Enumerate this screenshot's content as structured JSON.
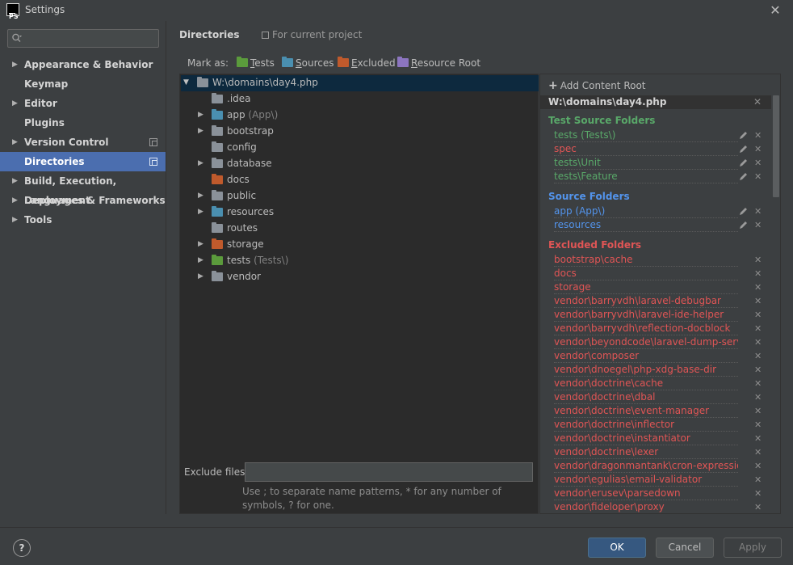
{
  "window": {
    "title": "Settings",
    "app_logo": "PS",
    "close_icon": "close-icon"
  },
  "sidebar": {
    "search": {
      "placeholder": "",
      "value": ""
    },
    "items": [
      {
        "label": "Appearance & Behavior",
        "has_arrow": true,
        "has_copy": false,
        "selected": false
      },
      {
        "label": "Keymap",
        "has_arrow": false,
        "has_copy": false,
        "selected": false
      },
      {
        "label": "Editor",
        "has_arrow": true,
        "has_copy": false,
        "selected": false
      },
      {
        "label": "Plugins",
        "has_arrow": false,
        "has_copy": false,
        "selected": false
      },
      {
        "label": "Version Control",
        "has_arrow": true,
        "has_copy": true,
        "selected": false
      },
      {
        "label": "Directories",
        "has_arrow": false,
        "has_copy": true,
        "selected": true
      },
      {
        "label": "Build, Execution, Deployment",
        "has_arrow": true,
        "has_copy": false,
        "selected": false
      },
      {
        "label": "Languages & Frameworks",
        "has_arrow": true,
        "has_copy": false,
        "selected": false
      },
      {
        "label": "Tools",
        "has_arrow": true,
        "has_copy": false,
        "selected": false
      }
    ]
  },
  "header": {
    "title": "Directories",
    "scope": "For current project"
  },
  "mark_as": {
    "label": "Mark as:",
    "buttons": [
      {
        "first": "T",
        "rest": "ests",
        "color": "#5b9b3c"
      },
      {
        "first": "S",
        "rest": "ources",
        "color": "#4a8fb0"
      },
      {
        "first": "E",
        "rest": "xcluded",
        "color": "#c05a2c"
      },
      {
        "first": "R",
        "rest": "esource Root",
        "color": "#8c75c0"
      }
    ]
  },
  "tree": {
    "root": "W:\\domains\\day4.php",
    "children": [
      {
        "name": ".idea",
        "hint": "",
        "expandable": false,
        "color": "#8a9199",
        "text_color": "#bbbbbb"
      },
      {
        "name": "app",
        "hint": " (App\\)",
        "expandable": true,
        "color": "#4a8fb0",
        "text_color": "#bbbbbb"
      },
      {
        "name": "bootstrap",
        "hint": "",
        "expandable": true,
        "color": "#8a9199",
        "text_color": "#bbbbbb"
      },
      {
        "name": "config",
        "hint": "",
        "expandable": false,
        "color": "#8a9199",
        "text_color": "#bbbbbb"
      },
      {
        "name": "database",
        "hint": "",
        "expandable": true,
        "color": "#8a9199",
        "text_color": "#bbbbbb"
      },
      {
        "name": "docs",
        "hint": "",
        "expandable": false,
        "color": "#c05a2c",
        "text_color": "#bbbbbb"
      },
      {
        "name": "public",
        "hint": "",
        "expandable": true,
        "color": "#8a9199",
        "text_color": "#bbbbbb"
      },
      {
        "name": "resources",
        "hint": "",
        "expandable": true,
        "color": "#4a8fb0",
        "text_color": "#bbbbbb"
      },
      {
        "name": "routes",
        "hint": "",
        "expandable": false,
        "color": "#8a9199",
        "text_color": "#bbbbbb"
      },
      {
        "name": "storage",
        "hint": "",
        "expandable": true,
        "color": "#c05a2c",
        "text_color": "#bbbbbb"
      },
      {
        "name": "tests",
        "hint": " (Tests\\)",
        "expandable": true,
        "color": "#5b9b3c",
        "text_color": "#bbbbbb"
      },
      {
        "name": "vendor",
        "hint": "",
        "expandable": true,
        "color": "#8a9199",
        "text_color": "#bbbbbb"
      }
    ]
  },
  "exclude_files": {
    "label": "Exclude files:",
    "value": "",
    "help": "Use ; to separate name patterns, * for any number of symbols, ? for one."
  },
  "content_root": {
    "add_label": "Add Content Root",
    "path": "W:\\domains\\day4.php",
    "sections": [
      {
        "title": "Test Source Folders",
        "color": "#59a869",
        "editable": true,
        "entries": [
          {
            "text": "tests (Tests\\)",
            "color": "#59a869"
          },
          {
            "text": "spec",
            "color": "#e05555"
          },
          {
            "text": "tests\\Unit",
            "color": "#59a869"
          },
          {
            "text": "tests\\Feature",
            "color": "#59a869"
          }
        ]
      },
      {
        "title": "Source Folders",
        "color": "#5394ec",
        "editable": true,
        "entries": [
          {
            "text": "app (App\\)",
            "color": "#5394ec"
          },
          {
            "text": "resources",
            "color": "#5394ec"
          }
        ]
      },
      {
        "title": "Excluded Folders",
        "color": "#e05555",
        "editable": false,
        "entries": [
          {
            "text": "bootstrap\\cache",
            "color": "#e05555"
          },
          {
            "text": "docs",
            "color": "#e05555"
          },
          {
            "text": "storage",
            "color": "#e05555"
          },
          {
            "text": "vendor\\barryvdh\\laravel-debugbar",
            "color": "#e05555"
          },
          {
            "text": "vendor\\barryvdh\\laravel-ide-helper",
            "color": "#e05555"
          },
          {
            "text": "vendor\\barryvdh\\reflection-docblock",
            "color": "#e05555"
          },
          {
            "text": "vendor\\beyondcode\\laravel-dump-server",
            "color": "#e05555"
          },
          {
            "text": "vendor\\composer",
            "color": "#e05555"
          },
          {
            "text": "vendor\\dnoegel\\php-xdg-base-dir",
            "color": "#e05555"
          },
          {
            "text": "vendor\\doctrine\\cache",
            "color": "#e05555"
          },
          {
            "text": "vendor\\doctrine\\dbal",
            "color": "#e05555"
          },
          {
            "text": "vendor\\doctrine\\event-manager",
            "color": "#e05555"
          },
          {
            "text": "vendor\\doctrine\\inflector",
            "color": "#e05555"
          },
          {
            "text": "vendor\\doctrine\\instantiator",
            "color": "#e05555"
          },
          {
            "text": "vendor\\doctrine\\lexer",
            "color": "#e05555"
          },
          {
            "text": "vendor\\dragonmantank\\cron-expression",
            "color": "#e05555"
          },
          {
            "text": "vendor\\egulias\\email-validator",
            "color": "#e05555"
          },
          {
            "text": "vendor\\erusev\\parsedown",
            "color": "#e05555"
          },
          {
            "text": "vendor\\fideloper\\proxy",
            "color": "#e05555"
          }
        ]
      }
    ]
  },
  "footer": {
    "help": "?",
    "ok": "OK",
    "cancel": "Cancel",
    "apply": "Apply"
  }
}
